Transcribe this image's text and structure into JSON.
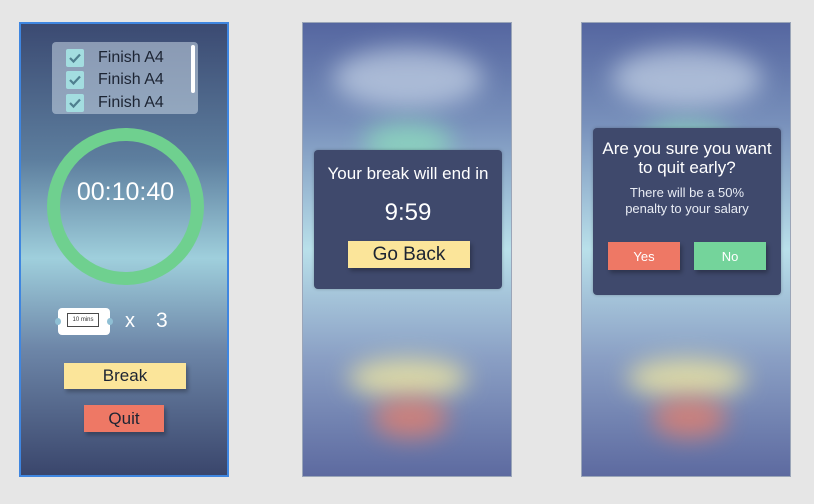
{
  "timer_screen": {
    "tasks": [
      {
        "label": "Finish A4",
        "checked": true
      },
      {
        "label": "Finish A4",
        "checked": true
      },
      {
        "label": "Finish A4",
        "checked": true
      }
    ],
    "timer": "00:10:40",
    "ticket_label": "10 mins",
    "multiplier": "x",
    "ticket_count": "3",
    "break_label": "Break",
    "quit_label": "Quit"
  },
  "break_modal": {
    "title": "Your break will end in",
    "time_left": "9:59",
    "go_back_label": "Go Back"
  },
  "quit_modal": {
    "title_line1": "Are you sure you want",
    "title_line2": "to quit early?",
    "body_line1": "There will be a 50%",
    "body_line2": "penalty to your salary",
    "yes_label": "Yes",
    "no_label": "No"
  },
  "colors": {
    "accent_green": "#6fd08f",
    "button_cream": "#fbe59a",
    "button_red": "#ee7865",
    "modal_bg": "#3f496c"
  },
  "icons": [
    "check-icon",
    "ticket-icon"
  ]
}
